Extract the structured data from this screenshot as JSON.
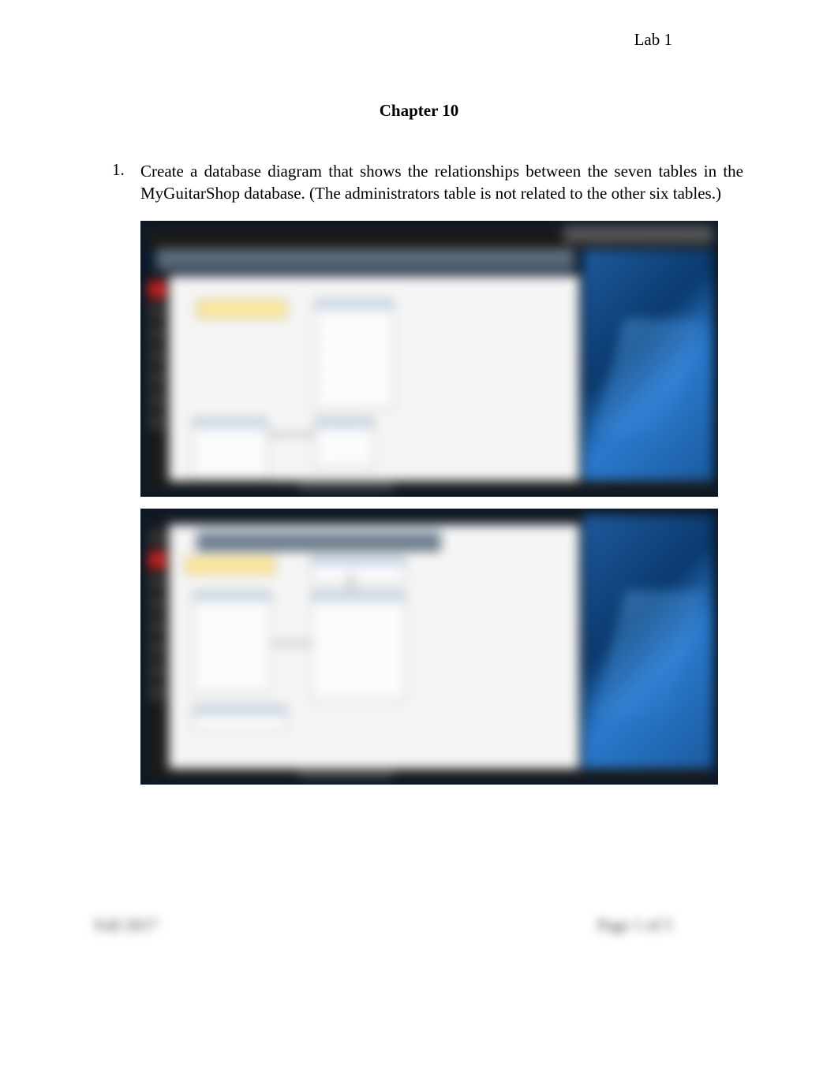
{
  "header": {
    "label": "Lab 1"
  },
  "chapter": {
    "title": "Chapter 10"
  },
  "question": {
    "number": "1.",
    "text": "Create a database diagram that shows the relationships between the seven tables in the MyGuitarShop database. (The administrators table is not related to the other six tables.)"
  },
  "footer": {
    "left": "Fall 2017",
    "right": "Page 1 of 5"
  },
  "screenshots": {
    "description": "Two blurred screenshots of SQL Server Management Studio database diagram designer showing table relationships on a Windows 10 desktop"
  }
}
